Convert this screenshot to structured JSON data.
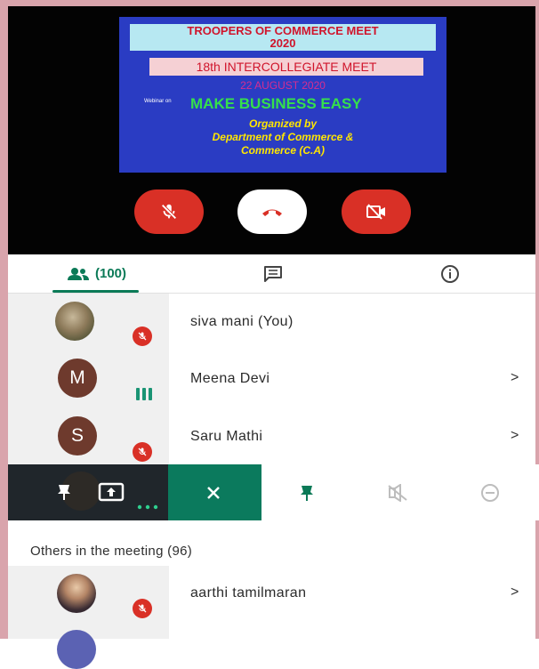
{
  "banner": {
    "line1": "TROOPERS OF COMMERCE MEET",
    "line1b": "2020",
    "line2": "18th INTERCOLLEGIATE MEET",
    "date": "22 AUGUST 2020",
    "webinar_on": "Webinar on",
    "topic": "MAKE BUSINESS EASY",
    "org1": "Organized by",
    "org2": "Department of Commerce &",
    "org3": "Commerce (C.A)"
  },
  "call_controls": [
    {
      "icon": "mic-off-icon",
      "color": "#d93026"
    },
    {
      "icon": "hang-up-icon",
      "color": "#ffffff"
    },
    {
      "icon": "camera-off-icon",
      "color": "#d93026"
    }
  ],
  "tabs": {
    "people_count": "(100)",
    "chat_icon": "chat-icon",
    "info_icon": "info-icon"
  },
  "participants": [
    {
      "name": "siva mani (You)",
      "muted": true,
      "avatar": "photo"
    },
    {
      "name": "Meena Devi",
      "avatar_letter": "M",
      "speaking": true
    },
    {
      "name": "Saru Mathi",
      "avatar_letter": "S",
      "muted": true
    }
  ],
  "action_bar": {
    "icons": [
      "pin-icon",
      "present-icon",
      "more-icon",
      "close-icon",
      "pin-icon",
      "mute-icon",
      "remove-icon"
    ]
  },
  "others_heading": "Others in the meeting (96)",
  "others": [
    {
      "name": "aarthi tamilmaran",
      "muted": true,
      "avatar": "photo"
    }
  ],
  "colors": {
    "accent": "#0b7a57",
    "danger": "#d93026"
  }
}
